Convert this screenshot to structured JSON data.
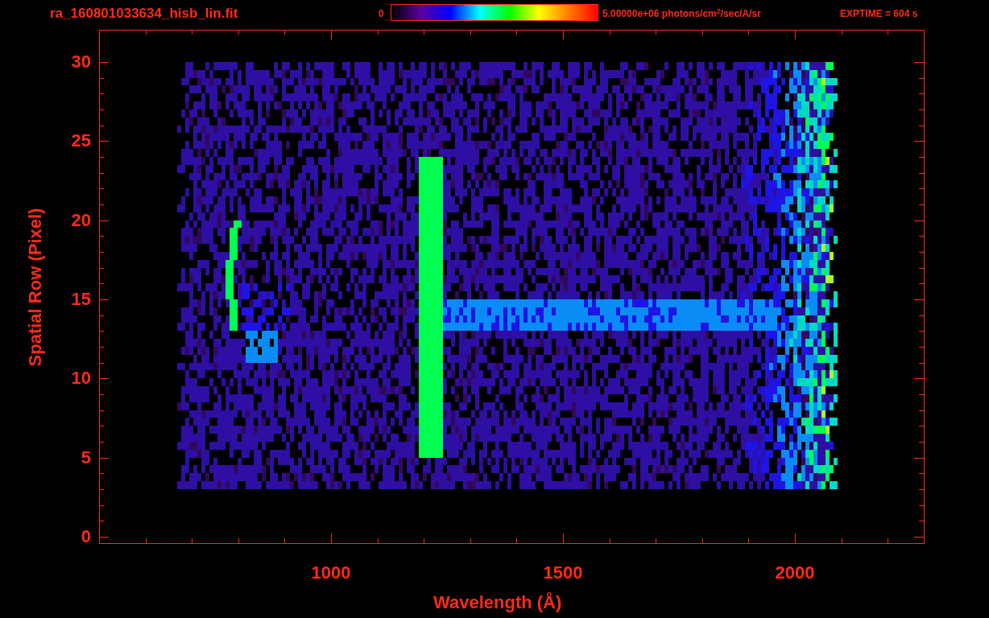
{
  "title": "ra_160801033634_hisb_lin.fit",
  "colorbar": {
    "min_label": "0",
    "max_label": "5.00000e+06 photons/cm$^{2}$/sec/A/sr"
  },
  "exposure": "EXPTIME = 604 s",
  "plot": {
    "xlabel": "Wavelength (Å)",
    "ylabel": "Spatial Row (Pixel)",
    "xticks": [
      "1000",
      "1500",
      "2000"
    ],
    "yticks": [
      "30",
      "25",
      "20",
      "15",
      "10",
      "5",
      "0"
    ]
  }
}
